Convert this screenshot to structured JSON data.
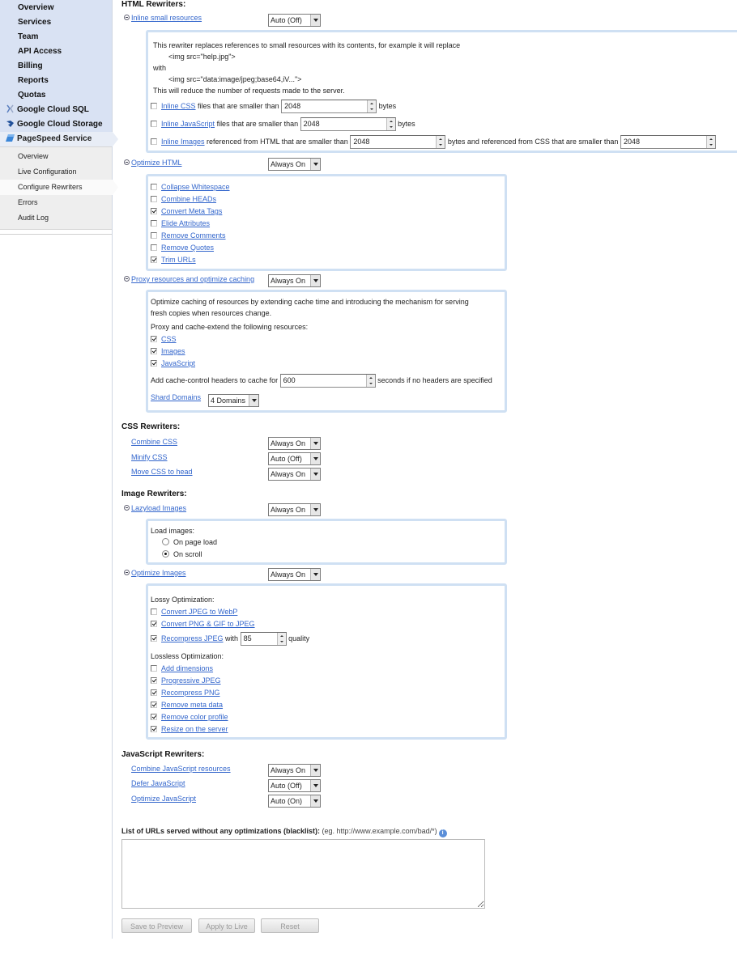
{
  "sidebar": {
    "top_items": [
      {
        "label": "Overview"
      },
      {
        "label": "Services"
      },
      {
        "label": "Team"
      },
      {
        "label": "API Access"
      },
      {
        "label": "Billing"
      },
      {
        "label": "Reports"
      },
      {
        "label": "Quotas"
      }
    ],
    "cloud_sql": {
      "label": "Google Cloud SQL",
      "icon": "cloud-sql-icon"
    },
    "cloud_storage": {
      "label": "Google Cloud Storage",
      "icon": "cloud-storage-icon"
    },
    "pagespeed": {
      "label": "PageSpeed Service",
      "icon": "pagespeed-icon"
    },
    "sub_items": [
      {
        "label": "Overview"
      },
      {
        "label": "Live Configuration"
      },
      {
        "label": "Configure Rewriters",
        "active": true
      },
      {
        "label": "Errors"
      },
      {
        "label": "Audit Log"
      }
    ]
  },
  "html_rewriters": {
    "heading": "HTML Rewriters:",
    "inline_small": {
      "label": "Inline small resources",
      "mode": "Auto (Off)",
      "desc1": "This rewriter replaces references to small resources with its contents, for example it will replace",
      "code1": "<img src=\"help.jpg\">",
      "with": "with",
      "code2": "<img src=\"data:image/jpeg;base64,iV...\">",
      "desc2": "This will reduce the number of requests made to the server.",
      "inline_css": {
        "link": "Inline CSS",
        "text": "files that are smaller than",
        "value": "2048",
        "unit": "bytes",
        "checked": false
      },
      "inline_js": {
        "link": "Inline JavaScript",
        "text": "files that are smaller than",
        "value": "2048",
        "unit": "bytes",
        "checked": false
      },
      "inline_images": {
        "link": "Inline Images",
        "text": "referenced from HTML that are smaller than",
        "value": "2048",
        "text2": "bytes and referenced from CSS that are smaller than",
        "value2": "2048",
        "checked": false
      }
    },
    "optimize_html": {
      "label": "Optimize HTML",
      "mode": "Always On",
      "options": [
        {
          "label": "Collapse Whitespace",
          "checked": false
        },
        {
          "label": "Combine HEADs",
          "checked": false
        },
        {
          "label": "Convert Meta Tags",
          "checked": true
        },
        {
          "label": "Elide Attributes",
          "checked": false
        },
        {
          "label": "Remove Comments",
          "checked": false
        },
        {
          "label": "Remove Quotes",
          "checked": false
        },
        {
          "label": "Trim URLs",
          "checked": true
        }
      ]
    },
    "proxy": {
      "label": "Proxy resources and optimize caching",
      "mode": "Always On",
      "desc1": "Optimize caching of resources by extending cache time and introducing the mechanism for serving",
      "desc2": "fresh copies when resources change.",
      "resources_label": "Proxy and cache-extend the following resources:",
      "resources": [
        {
          "label": "CSS",
          "checked": true
        },
        {
          "label": "Images",
          "checked": true
        },
        {
          "label": "JavaScript",
          "checked": true
        }
      ],
      "cache_label": "Add cache-control headers to cache for",
      "cache_value": "600",
      "cache_suffix": "seconds if no headers are specified",
      "shard_label": "Shard Domains",
      "shard_value": "4 Domains"
    }
  },
  "css_rewriters": {
    "heading": "CSS Rewriters:",
    "items": [
      {
        "label": "Combine CSS",
        "mode": "Always On"
      },
      {
        "label": "Minify CSS",
        "mode": "Auto (Off)"
      },
      {
        "label": "Move CSS to head",
        "mode": "Always On"
      }
    ]
  },
  "image_rewriters": {
    "heading": "Image Rewriters:",
    "lazyload": {
      "label": "Lazyload Images",
      "mode": "Always On",
      "load_label": "Load images:",
      "options": [
        {
          "label": "On page load",
          "checked": false
        },
        {
          "label": "On scroll",
          "checked": true
        }
      ]
    },
    "optimize": {
      "label": "Optimize Images",
      "mode": "Always On",
      "lossy_label": "Lossy Optimization:",
      "lossy": [
        {
          "label": "Convert JPEG to WebP",
          "checked": false
        },
        {
          "label": "Convert PNG & GIF to JPEG",
          "checked": true
        }
      ],
      "recompress": {
        "label": "Recompress JPEG",
        "with": "with",
        "value": "85",
        "suffix": "quality",
        "checked": true
      },
      "lossless_label": "Lossless Optimization:",
      "lossless": [
        {
          "label": "Add dimensions",
          "checked": false
        },
        {
          "label": "Progressive JPEG",
          "checked": true
        },
        {
          "label": "Recompress PNG",
          "checked": true
        },
        {
          "label": "Remove meta data",
          "checked": true
        },
        {
          "label": "Remove color profile",
          "checked": true
        },
        {
          "label": "Resize on the server",
          "checked": true
        }
      ]
    }
  },
  "js_rewriters": {
    "heading": "JavaScript Rewriters:",
    "items": [
      {
        "label": "Combine JavaScript resources",
        "mode": "Always On"
      },
      {
        "label": "Defer JavaScript",
        "mode": "Auto (Off)"
      },
      {
        "label": "Optimize JavaScript",
        "mode": "Auto (On)"
      }
    ]
  },
  "blacklist": {
    "label": "List of URLs served without any optimizations (blacklist):",
    "hint": "(eg. http://www.example.com/bad/*)",
    "help_icon": "help-icon",
    "value": ""
  },
  "buttons": {
    "save": "Save to Preview",
    "apply": "Apply to Live",
    "reset": "Reset"
  },
  "colors": {
    "link": "#3366cc",
    "panel_border": "#cfe0f3",
    "nav_bg": "#d9e2f3"
  }
}
